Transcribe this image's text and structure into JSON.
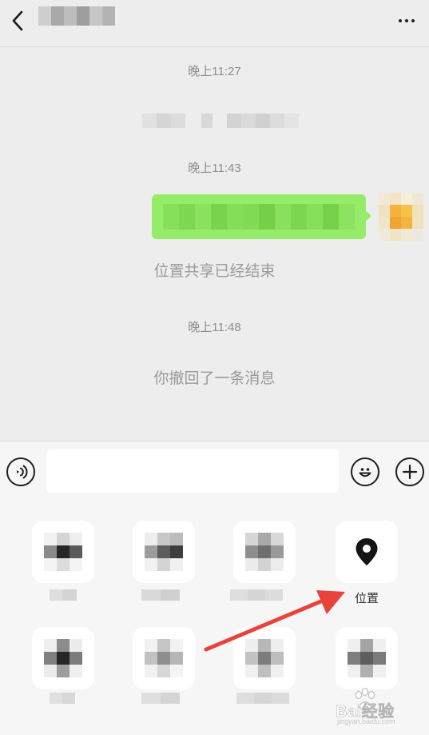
{
  "chat": {
    "timestamp_1": "晚上11:27",
    "timestamp_2": "晚上11:43",
    "system_location_share_ended": "位置共享已经结束",
    "timestamp_3": "晚上11:48",
    "system_recalled": "你撤回了一条消息"
  },
  "input_bar": {
    "voice_icon": "voice-icon",
    "emoji_icon": "emoji-icon",
    "plus_icon": "plus-icon",
    "message_value": ""
  },
  "panel": {
    "location_label": "位置",
    "location_icon": "location-pin-icon"
  },
  "watermark": {
    "text": "Bai经验",
    "subtext": "jingyan.baidu.com"
  },
  "colors": {
    "background": "#ededed",
    "sent_bubble": "#95ec69",
    "annotation_arrow": "#e8433a"
  }
}
